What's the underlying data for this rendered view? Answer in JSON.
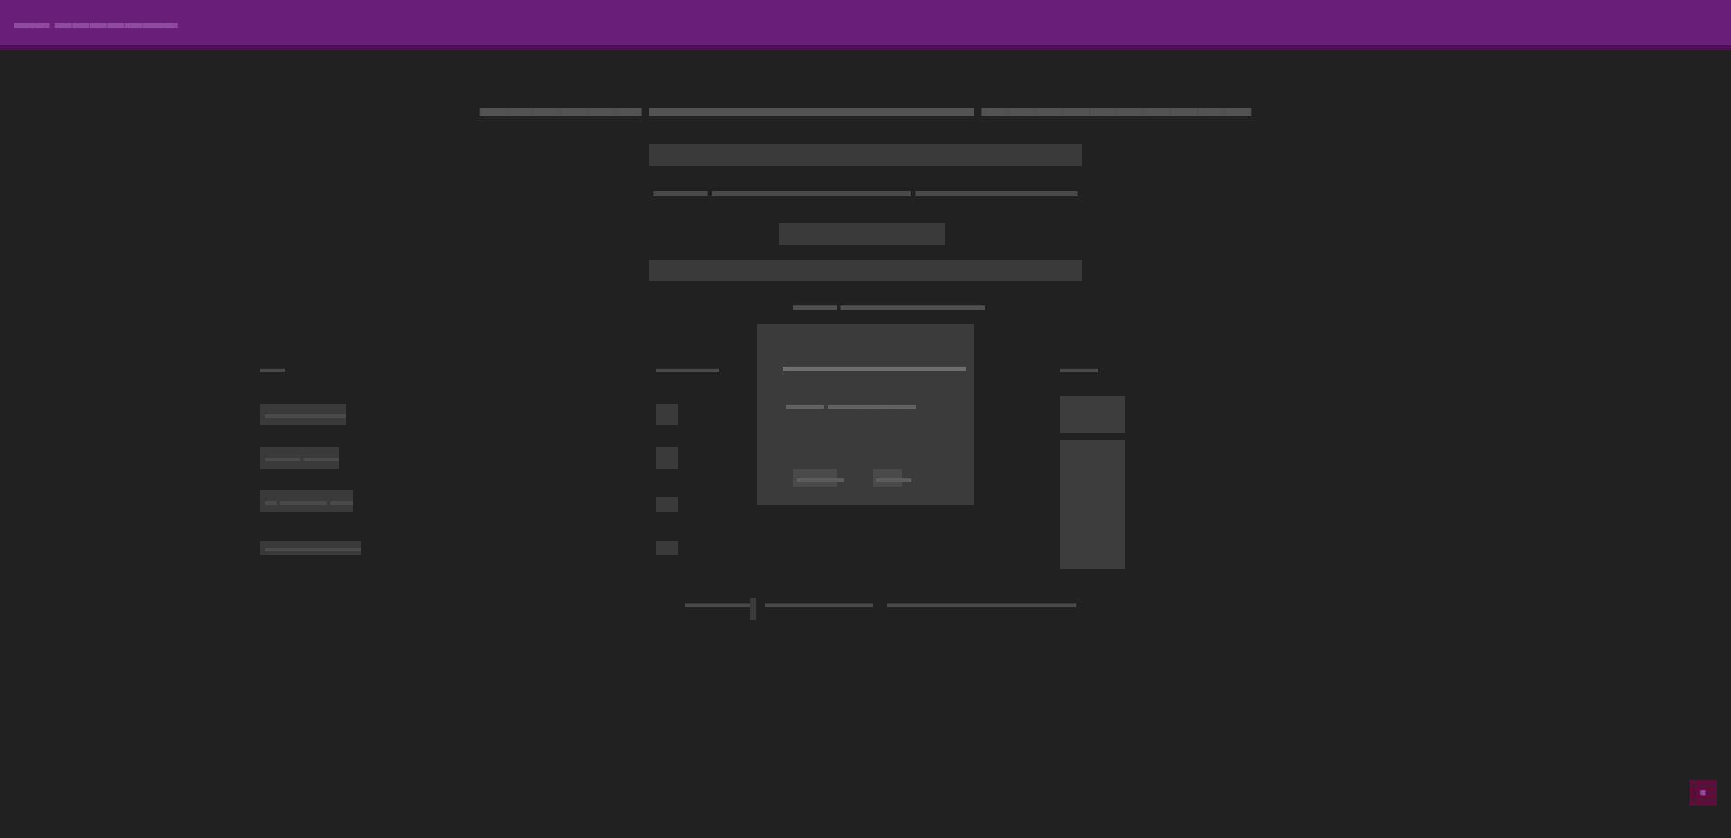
{
  "app": {
    "title": "▬▬ ▬▬▬▬▬▬▬"
  },
  "main": {
    "headline": "▬▬▬▬▬▬ ▬▬▬▬▬▬▬▬▬▬▬▬ ▬▬▬▬▬▬▬▬▬▬",
    "status_line": "▬▬▬ ▬▬▬▬▬▬▬▬▬▬▬ ▬▬▬▬▬▬▬▬▬",
    "action_button": "",
    "panel_caption": "▬▬▬ ▬▬▬▬▬▬▬▬▬▬"
  },
  "dialog": {
    "title": "▬▬▬▬▬▬▬▬▬▬▬▬",
    "subtitle": "▬▬▬ ▬▬▬▬▬▬▬",
    "ok_label": "▬▬▬▬",
    "cancel_label": "▬▬▬"
  },
  "columns": {
    "left_heading": "▬▬",
    "mid_heading": "▬▬▬▬▬",
    "right_heading": "▬▬▬"
  },
  "left_items": [
    "▬▬▬▬▬▬▬",
    "▬▬▬ ▬▬▬▬",
    "▬ ▬▬▬▬ ▬▬",
    "▬▬▬▬▬▬▬▬▬"
  ],
  "footer": {
    "link1": "▬▬▬▬▬",
    "link2": "▬▬▬▬▬▬▬▬",
    "link3": "▬▬▬▬▬▬▬▬▬▬▬▬▬▬"
  },
  "corner_badge": {
    "icon": "square-icon"
  },
  "colors": {
    "topbar": "#6a1f78",
    "topbar_border": "#4c0e57",
    "background": "#212121",
    "badge": "#5a0e39"
  }
}
